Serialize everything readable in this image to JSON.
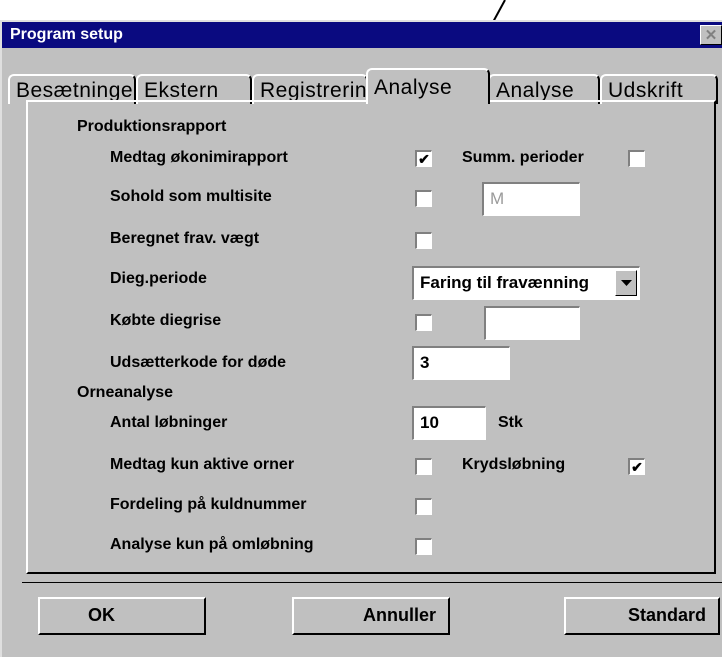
{
  "window": {
    "title": "Program setup",
    "close_glyph": "✕"
  },
  "tabs": [
    {
      "label": "Besætninger",
      "active": false
    },
    {
      "label": "Ekstern",
      "active": false
    },
    {
      "label": "Registrering",
      "active": false
    },
    {
      "label": "Analyse",
      "active": true
    },
    {
      "label": "Analyse",
      "active": false
    },
    {
      "label": "Udskrift",
      "active": false
    }
  ],
  "produktion": {
    "heading": "Produktionsrapport",
    "medtag_oekonomi": {
      "label": "Medtag økonimirapport",
      "checked": true
    },
    "summ_perioder": {
      "label": "Summ. perioder",
      "checked": false
    },
    "sohold_multisite": {
      "label": "Sohold som multisite",
      "checked": false,
      "field_value": "M"
    },
    "beregnet_frav": {
      "label": "Beregnet frav. vægt",
      "checked": false
    },
    "dieg_periode": {
      "label": "Dieg.periode",
      "selected": "Faring til fravænning"
    },
    "koebte_diegrise": {
      "label": "Købte diegrise",
      "checked": false,
      "field_value": ""
    },
    "udsaetterkode": {
      "label": "Udsætterkode for døde",
      "value": "3"
    }
  },
  "orne": {
    "heading": "Orneanalyse",
    "antal_loebninger": {
      "label": "Antal løbninger",
      "value": "10",
      "unit": "Stk"
    },
    "medtag_aktive": {
      "label": "Medtag kun aktive orner",
      "checked": false
    },
    "krydsloebning": {
      "label": "Krydsløbning",
      "checked": true
    },
    "fordeling_kuld": {
      "label": "Fordeling på kuldnummer",
      "checked": false
    },
    "analyse_omloeb": {
      "label": "Analyse kun på omløbning",
      "checked": false
    }
  },
  "buttons": {
    "ok": "OK",
    "annuller": "Annuller",
    "standard": "Standard"
  },
  "check_glyph": "✔"
}
